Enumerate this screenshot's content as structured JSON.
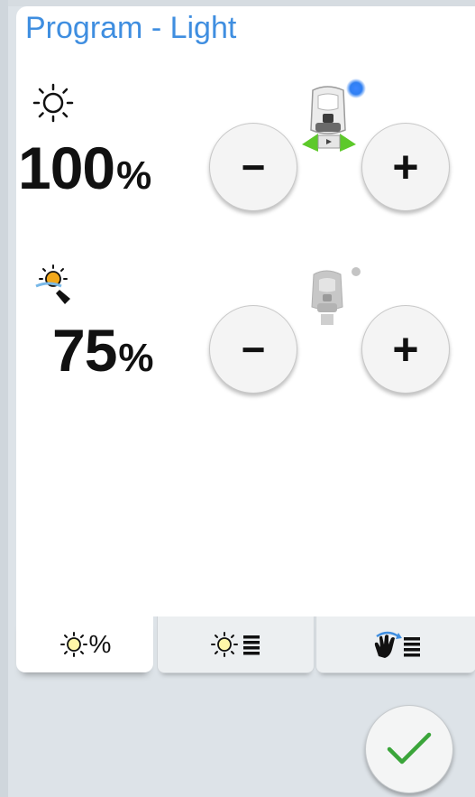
{
  "header": {
    "title": "Program - Light"
  },
  "main_light": {
    "icon": "sun-outline-icon",
    "value": "100",
    "unit": "%",
    "status_dot_color": "#2f7ff2",
    "lamp_icon": "lamp-active-icon",
    "decrease_label": "−",
    "increase_label": "+"
  },
  "ambient_light": {
    "icon": "sun-dimmer-icon",
    "value": "75",
    "unit": "%",
    "status_dot_color": "#b9b9b9",
    "lamp_icon": "lamp-inactive-icon",
    "decrease_label": "−",
    "increase_label": "+"
  },
  "tabs": [
    {
      "icon": "sun-percent-icon",
      "label": "%",
      "active": true
    },
    {
      "icon": "sun-list-icon",
      "label": "",
      "active": false
    },
    {
      "icon": "gesture-list-icon",
      "label": "",
      "active": false
    }
  ],
  "footer": {
    "confirm_icon": "checkmark-icon",
    "accent_color": "#3aa53a"
  }
}
